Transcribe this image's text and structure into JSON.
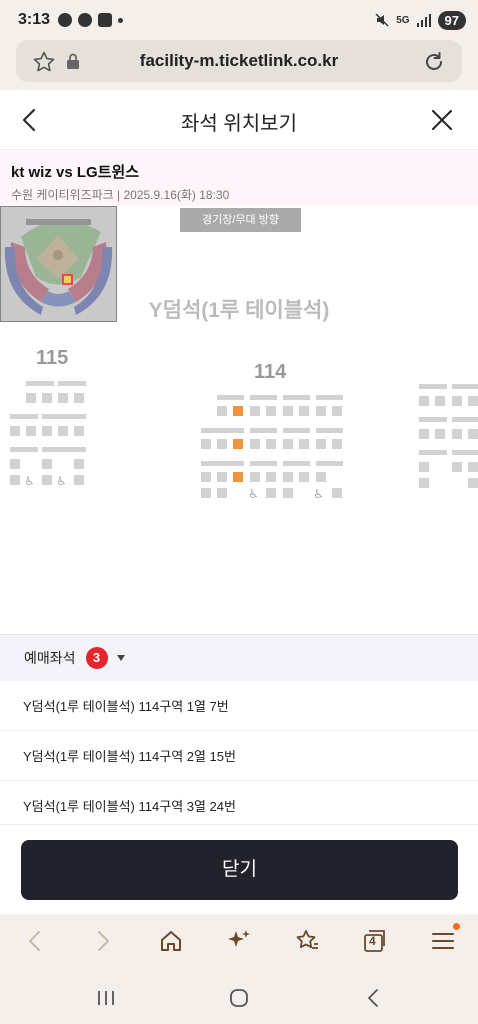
{
  "status_bar": {
    "time": "3:13",
    "battery": "97",
    "network": "5G"
  },
  "browser": {
    "url": "facility-m.ticketlink.co.kr",
    "tab_count": "4"
  },
  "header": {
    "title": "좌석 위치보기"
  },
  "event": {
    "title": "kt wiz vs LG트윈스",
    "venue_datetime": "수원 케이티위즈파크 | 2025.9.16(화) 18:30"
  },
  "seat_map": {
    "stage_label": "경기장/무대 방향",
    "zone_name": "Y덤석(1루 테이블석)",
    "sections": [
      "115",
      "114"
    ],
    "accent_color": "#f0953c"
  },
  "selected": {
    "label": "예매좌석",
    "count": "3",
    "seats": [
      "Y덤석(1루 테이블석) 114구역 1열 7번",
      "Y덤석(1루 테이블석) 114구역 2열 15번",
      "Y덤석(1루 테이블석) 114구역 3열 24번"
    ]
  },
  "close_button": "닫기",
  "colors": {
    "brand_dark": "#22222c",
    "badge_red": "#e5242c",
    "chrome_bg": "#f4efea"
  }
}
